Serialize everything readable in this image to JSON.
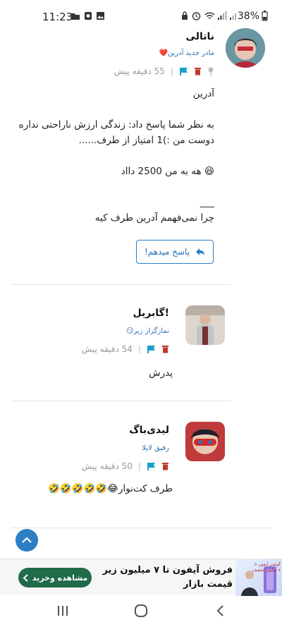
{
  "status_bar": {
    "time": "11:23",
    "battery": "38%"
  },
  "posts": [
    {
      "name": "ناتالی",
      "rank": "مادر جدید آدرین❤️",
      "time": "55 دقیقه پیش",
      "lines": [
        "آدرین",
        "",
        "به نظر شما پاسخ داد: زندگی ارزش ناراحتی نداره",
        "دوست من :)1 امتیاز از طرف......",
        "",
        "😆 هه به من 2500 دااد",
        "",
        "___",
        "چرا نمی‌فهمم آدرین طرف کیه"
      ],
      "reply_label": "پاسخ میدهم!"
    },
    {
      "name": "گابریل!",
      "rank": "نمازگزار زیر😏",
      "time": "54 دقیقه پیش",
      "lines": [
        "پدرش"
      ]
    },
    {
      "name": "لیدی‌باگ",
      "rank": "رفیق لایلا",
      "time": "50 دقیقه پیش",
      "lines": [
        "طرف کت‌نوار😂🤣🤣🤣🤣🤣"
      ]
    }
  ],
  "ad": {
    "cta": "مشاهده وخرید",
    "text": "فروش آیفون تا ۷ میلیون زیر قیمت بازار",
    "image_label": "گوشی آیفون تا ۷ میلیون تخفیف"
  },
  "colors": {
    "accent": "#2a7fc5",
    "delete": "#c0392b",
    "flag": "#1a9fc9",
    "ad_cta": "#1f6b4a"
  }
}
